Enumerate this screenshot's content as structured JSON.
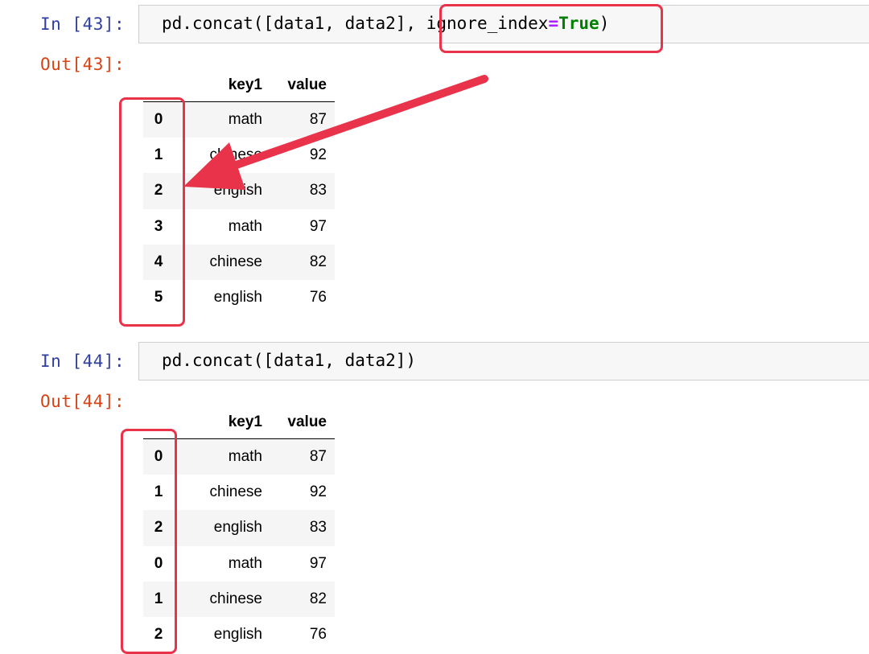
{
  "cells": [
    {
      "in_prompt": "In [43]:",
      "code_prefix": "pd.concat([data1, data2], ",
      "code_param": "ignore_index",
      "code_op": "=",
      "code_value": "True",
      "code_suffix": ")",
      "out_prompt": "Out[43]:",
      "columns": [
        "key1",
        "value"
      ],
      "rows": [
        {
          "index": "0",
          "key1": "math",
          "value": "87"
        },
        {
          "index": "1",
          "key1": "chinese",
          "value": "92"
        },
        {
          "index": "2",
          "key1": "english",
          "value": "83"
        },
        {
          "index": "3",
          "key1": "math",
          "value": "97"
        },
        {
          "index": "4",
          "key1": "chinese",
          "value": "82"
        },
        {
          "index": "5",
          "key1": "english",
          "value": "76"
        }
      ]
    },
    {
      "in_prompt": "In [44]:",
      "code": "pd.concat([data1, data2])",
      "out_prompt": "Out[44]:",
      "columns": [
        "key1",
        "value"
      ],
      "rows": [
        {
          "index": "0",
          "key1": "math",
          "value": "87"
        },
        {
          "index": "1",
          "key1": "chinese",
          "value": "92"
        },
        {
          "index": "2",
          "key1": "english",
          "value": "83"
        },
        {
          "index": "0",
          "key1": "math",
          "value": "97"
        },
        {
          "index": "1",
          "key1": "chinese",
          "value": "82"
        },
        {
          "index": "2",
          "key1": "english",
          "value": "76"
        }
      ]
    }
  ],
  "colors": {
    "highlight": "#e8334a",
    "prompt_in": "#303f9f",
    "prompt_out": "#d84315"
  }
}
